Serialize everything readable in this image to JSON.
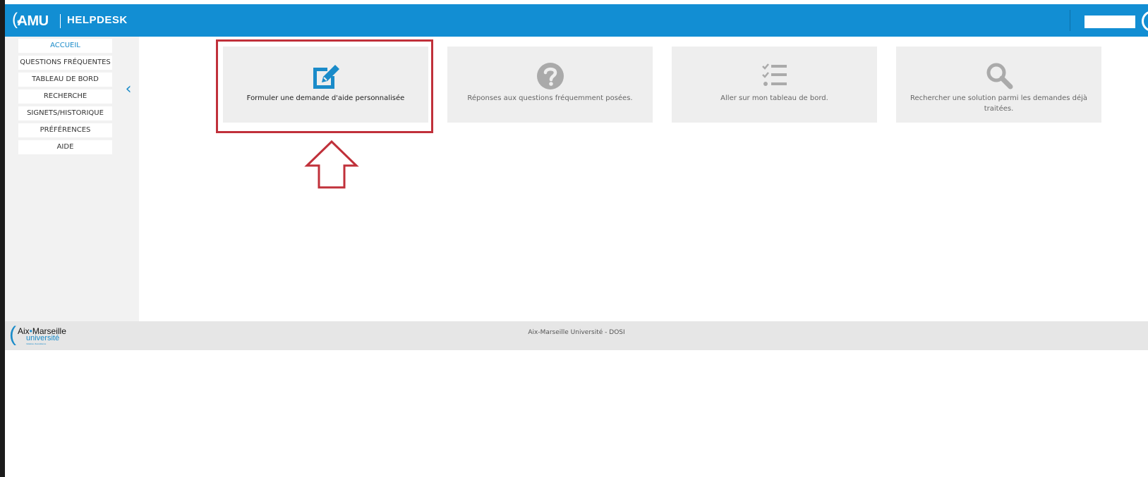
{
  "header": {
    "logo_text": "AMU",
    "app_title": "HELPDESK"
  },
  "sidebar": {
    "items": [
      {
        "label": "ACCUEIL"
      },
      {
        "label": "QUESTIONS FRÉQUENTES"
      },
      {
        "label": "TABLEAU DE BORD"
      },
      {
        "label": "RECHERCHE"
      },
      {
        "label": "SIGNETS/HISTORIQUE"
      },
      {
        "label": "PRÉFÉRENCES"
      },
      {
        "label": "AIDE"
      }
    ],
    "collapse_glyph": "‹"
  },
  "tiles": [
    {
      "label": "Formuler une demande d'aide personnalisée",
      "icon": "edit-icon"
    },
    {
      "label": "Réponses aux questions fréquemment posées.",
      "icon": "question-circle-icon"
    },
    {
      "label": "Aller sur mon tableau de bord.",
      "icon": "checklist-icon"
    },
    {
      "label": "Rechercher une solution parmi les demandes déjà traitées.",
      "icon": "search-icon"
    }
  ],
  "footer": {
    "logo_line1_a": "Aix",
    "logo_line1_b": "Marseille",
    "logo_line2": "université",
    "logo_line3": "Initiative d'excellence",
    "text": "Aix-Marseille Université - DOSI"
  },
  "colors": {
    "header_blue": "#128ed3",
    "accent_blue": "#1a8bc9",
    "annotation_red": "#c0303a",
    "tile_bg": "#eeeeee",
    "icon_grey": "#aaaaaa"
  }
}
